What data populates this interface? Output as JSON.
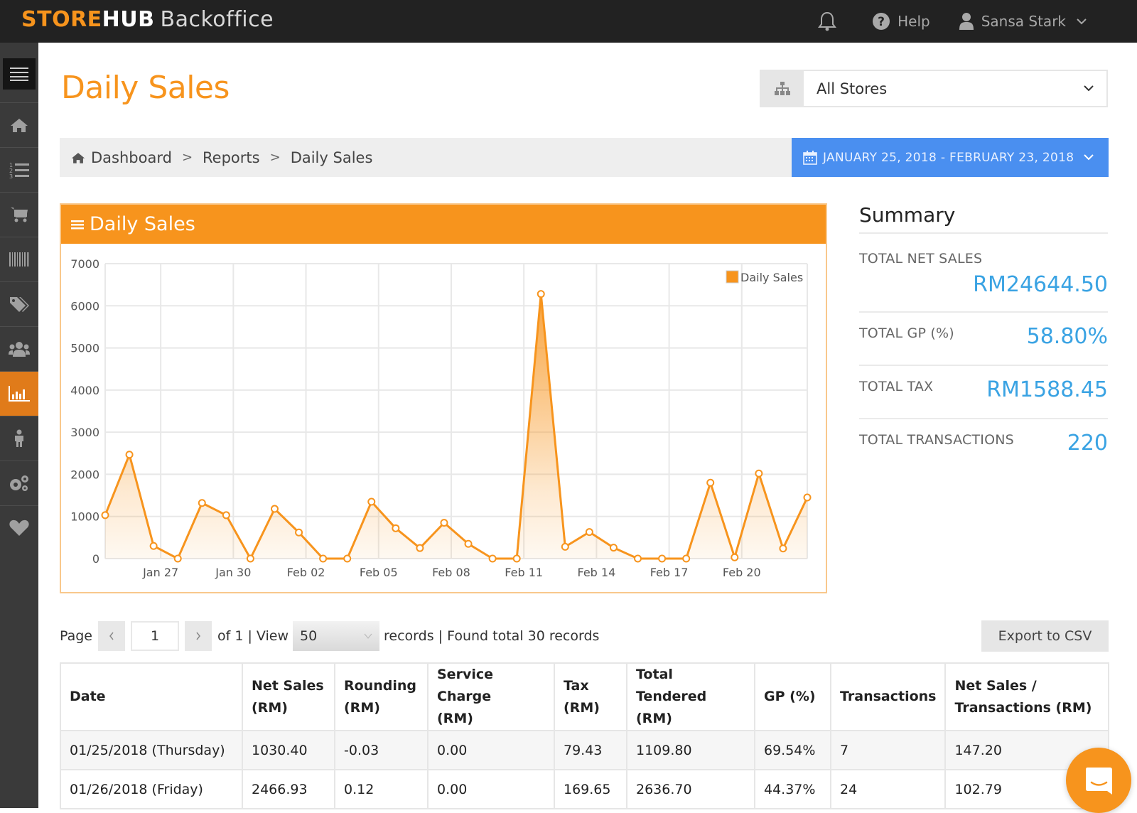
{
  "app": {
    "brand_part1": "STORE",
    "brand_part2": "HUB",
    "product": "Backoffice"
  },
  "topbar": {
    "notifications_icon": "bell-icon",
    "help_label": "Help",
    "user_name": "Sansa Stark"
  },
  "sidebar": {
    "items": [
      {
        "icon": "home-icon",
        "active": false
      },
      {
        "icon": "numbered-list-icon",
        "active": false
      },
      {
        "icon": "cart-icon",
        "active": false
      },
      {
        "icon": "barcode-icon",
        "active": false
      },
      {
        "icon": "tags-icon",
        "active": false
      },
      {
        "icon": "users-icon",
        "active": false
      },
      {
        "icon": "bar-chart-icon",
        "active": true
      },
      {
        "icon": "person-icon",
        "active": false
      },
      {
        "icon": "gears-icon",
        "active": false
      },
      {
        "icon": "heart-icon",
        "active": false
      }
    ]
  },
  "page": {
    "title": "Daily Sales",
    "store_select": "All Stores",
    "date_range": "JANUARY 25, 2018 - FEBRUARY 23, 2018"
  },
  "breadcrumb": [
    "Dashboard",
    "Reports",
    "Daily Sales"
  ],
  "chart_panel": {
    "title": "Daily Sales"
  },
  "chart_data": {
    "type": "area",
    "title": "Daily Sales",
    "xlabel": "",
    "ylabel": "",
    "ylim": [
      0,
      7000
    ],
    "yticks": [
      0,
      1000,
      2000,
      3000,
      4000,
      5000,
      6000,
      7000
    ],
    "grid": true,
    "legend": "top-right",
    "x": [
      "Jan 25",
      "Jan 26",
      "Jan 27",
      "Jan 28",
      "Jan 29",
      "Jan 30",
      "Jan 31",
      "Feb 01",
      "Feb 02",
      "Feb 03",
      "Feb 04",
      "Feb 05",
      "Feb 06",
      "Feb 07",
      "Feb 08",
      "Feb 09",
      "Feb 10",
      "Feb 11",
      "Feb 12",
      "Feb 13",
      "Feb 14",
      "Feb 15",
      "Feb 16",
      "Feb 17",
      "Feb 18",
      "Feb 19",
      "Feb 20",
      "Feb 21",
      "Feb 22",
      "Feb 23"
    ],
    "xtick_labels": [
      "Jan 27",
      "Jan 30",
      "Feb 02",
      "Feb 05",
      "Feb 08",
      "Feb 11",
      "Feb 14",
      "Feb 17",
      "Feb 20"
    ],
    "series": [
      {
        "name": "Daily Sales",
        "color": "#f7941d",
        "values": [
          1030.4,
          2466.93,
          300,
          0,
          1320,
          1030,
          0,
          1180,
          620,
          0,
          0,
          1350,
          720,
          250,
          850,
          350,
          0,
          0,
          6280,
          280,
          630,
          260,
          0,
          0,
          0,
          1800,
          30,
          2020,
          240,
          1450
        ]
      }
    ]
  },
  "summary": {
    "title": "Summary",
    "rows": [
      {
        "label": "TOTAL NET SALES",
        "value": "RM24644.50"
      },
      {
        "label": "TOTAL GP (%)",
        "value": "58.80%"
      },
      {
        "label": "TOTAL TAX",
        "value": "RM1588.45"
      },
      {
        "label": "TOTAL TRANSACTIONS",
        "value": "220"
      }
    ]
  },
  "pager": {
    "page_label": "Page",
    "current_page": "1",
    "of_text": "of 1 | View",
    "view_count": "50",
    "records_text": "records | Found total 30 records",
    "export_label": "Export to CSV"
  },
  "table": {
    "columns": [
      [
        "Date"
      ],
      [
        "Net Sales",
        "(RM)"
      ],
      [
        "Rounding",
        "(RM)"
      ],
      [
        "Service Charge",
        "(RM)"
      ],
      [
        "Tax",
        "(RM)"
      ],
      [
        "Total Tendered",
        "(RM)"
      ],
      [
        "GP (%)"
      ],
      [
        "Transactions"
      ],
      [
        "Net Sales /",
        "Transactions (RM)"
      ]
    ],
    "rows": [
      [
        "01/25/2018 (Thursday)",
        "1030.40",
        "-0.03",
        "0.00",
        "79.43",
        "1109.80",
        "69.54%",
        "7",
        "147.20"
      ],
      [
        "01/26/2018 (Friday)",
        "2466.93",
        "0.12",
        "0.00",
        "169.65",
        "2636.70",
        "44.37%",
        "24",
        "102.79"
      ]
    ]
  },
  "colors": {
    "brand_orange": "#f7941d",
    "accent_blue": "#4a8ff0",
    "summary_blue": "#3aa3e3",
    "topbar": "#222222",
    "sidebar": "#3a3a3a"
  }
}
